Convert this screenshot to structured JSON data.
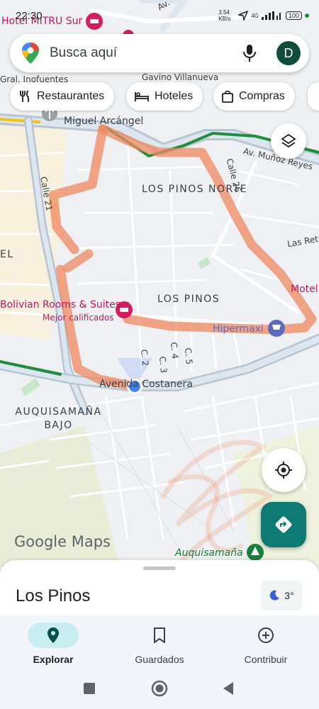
{
  "status_bar": {
    "time": "22:30",
    "speed": "3.54 KB/s",
    "network": "4G",
    "battery": "100"
  },
  "search": {
    "placeholder": "Busca aquí",
    "avatar_letter": "D"
  },
  "chips": [
    {
      "label": "Restaurantes",
      "icon": "fork-knife-icon"
    },
    {
      "label": "Hoteles",
      "icon": "bed-icon"
    },
    {
      "label": "Compras",
      "icon": "shopping-bag-icon"
    }
  ],
  "map": {
    "areas": [
      {
        "name": "LOS PINOS NORTE"
      },
      {
        "name": "LOS PINOS"
      },
      {
        "name": "AUQUISAMAÑA BAJO"
      },
      {
        "name": "EL"
      }
    ],
    "streets": [
      "Av. Muñoz Reyes",
      "Calle 26",
      "Calle 21",
      "Avenida Costanera",
      "C. 2",
      "C. 3",
      "C. 4",
      "C. 5",
      "Las Reta",
      "Miguel Arcángel",
      "Gavino Villanueva",
      "Gral. Inofuentes",
      "Av."
    ],
    "pois": [
      {
        "name": "Hotel MITRU Sur",
        "kind": "hotel"
      },
      {
        "name": "Bolivian Rooms & Suites",
        "subtitle": "Mejor calificados",
        "kind": "hotel"
      },
      {
        "name": "Hipermaxi",
        "kind": "shopping"
      },
      {
        "name": "Motel",
        "kind": "hotel"
      },
      {
        "name": "Auquisamaña",
        "kind": "park"
      }
    ],
    "colors": {
      "highlight_stroke": "#f0885f",
      "poi_pink": "#d81b60",
      "road_green": "#1e8e3e",
      "location_blue": "#4285f4",
      "directions_teal": "#0d7a73"
    }
  },
  "branding": "Google Maps",
  "sheet": {
    "title": "Los Pinos",
    "weather": "3°",
    "weather_icon": "moon-icon"
  },
  "bottom_nav": [
    {
      "label": "Explorar",
      "icon": "location-pin-icon",
      "active": true
    },
    {
      "label": "Guardados",
      "icon": "bookmark-icon",
      "active": false
    },
    {
      "label": "Contribuir",
      "icon": "plus-circle-icon",
      "active": false
    }
  ]
}
